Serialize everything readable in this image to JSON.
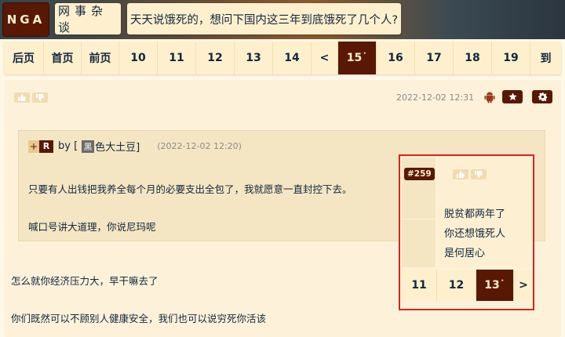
{
  "header": {
    "logo": "NGA",
    "forum": "网事杂谈",
    "topic_title": "天天说饿死的，想问下国内这三年到底饿死了几个人?"
  },
  "pager": {
    "items": [
      "后页",
      "首页",
      "前页",
      "10",
      "11",
      "12",
      "13",
      "14",
      "<",
      "15˙",
      "16",
      "17",
      "18",
      "19",
      "到"
    ],
    "active_index": 9
  },
  "post": {
    "timestamp": "2022-12-02 12:31",
    "quote": {
      "plus": "+",
      "rep": "R",
      "by": "by [",
      "author_avatar_char": "黑",
      "author_rest": "色大土豆]",
      "timestamp": "(2022-12-02 12:20)",
      "lines": [
        "只要有人出钱把我养全每个月的必要支出全包了，我就愿意一直封控下去。",
        "喊口号讲大道理，你说尼玛呢"
      ]
    },
    "lines": [
      "怎么就你经济压力大，早干嘛去了",
      "你们既然可以不顾别人健康安全，我们也可以说穷死你活该"
    ]
  },
  "popup": {
    "floor": "#259",
    "lines": [
      "脱贫都两年了",
      "你还想饿死人",
      "是何居心"
    ],
    "pager": [
      "11",
      "12",
      "13˙",
      ">"
    ],
    "active_index": 2
  },
  "colors": {
    "brand": "#591804",
    "bar_bg": "#fff0cd",
    "page_bg": "#fff8e7",
    "highlight_border": "#e02020"
  },
  "icons": [
    "thumb-up-icon",
    "thumb-down-icon",
    "android-icon",
    "star-icon",
    "gear-icon"
  ]
}
